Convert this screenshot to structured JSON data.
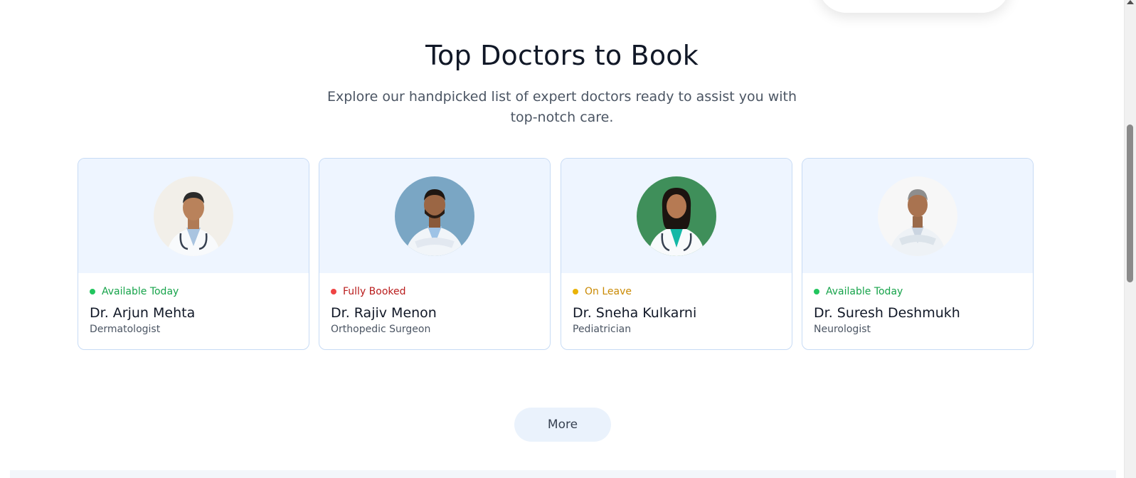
{
  "section": {
    "title": "Top Doctors to Book",
    "subtitle": "Explore our handpicked list of expert doctors ready to assist you with top-notch care."
  },
  "doctors": [
    {
      "status": "Available Today",
      "status_color": "#16a34a",
      "dot_color": "#22c55e",
      "name": "Dr. Arjun Mehta",
      "specialty": "Dermatologist",
      "avatar_bg": "#f2efe9"
    },
    {
      "status": "Fully Booked",
      "status_color": "#b91c1c",
      "dot_color": "#ef4444",
      "name": "Dr. Rajiv Menon",
      "specialty": "Orthopedic Surgeon",
      "avatar_bg": "#7aa6c4"
    },
    {
      "status": "On Leave",
      "status_color": "#ca8a04",
      "dot_color": "#eab308",
      "name": "Dr. Sneha Kulkarni",
      "specialty": "Pediatrician",
      "avatar_bg": "#3f8f5a"
    },
    {
      "status": "Available Today",
      "status_color": "#16a34a",
      "dot_color": "#22c55e",
      "name": "Dr. Suresh Deshmukh",
      "specialty": "Neurologist",
      "avatar_bg": "#f7f7f7"
    }
  ],
  "more_button": {
    "label": "More"
  },
  "colors": {
    "card_border": "#c7dbf5",
    "card_photo_bg": "#eef5ff",
    "button_bg": "#eaf2fc"
  }
}
